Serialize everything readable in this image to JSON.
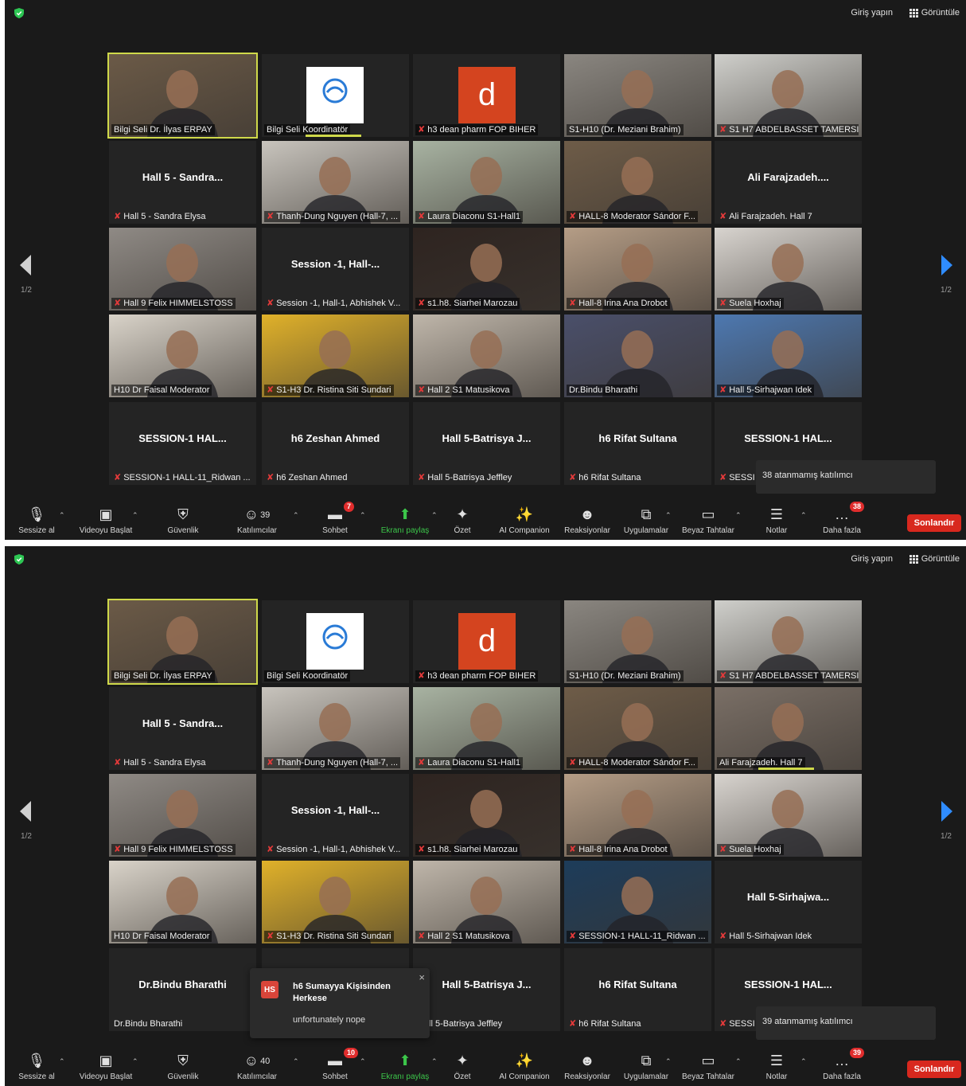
{
  "screens": [
    {
      "topbar": {
        "login": "Giriş yapın",
        "view": "Görüntüle"
      },
      "page_indicator": "1/2",
      "tiles": [
        {
          "name": "Bilgi Seli Dr. İlyas ERPAY",
          "muted": false,
          "kind": "video",
          "active": true,
          "bg": "#6b5a47"
        },
        {
          "name": "Bilgi Seli  Koordinatör",
          "muted": false,
          "kind": "logo",
          "speaking": true
        },
        {
          "name": "h3 dean pharm FOP BIHER",
          "muted": true,
          "kind": "letter",
          "letter": "d"
        },
        {
          "name": "S1-H10 (Dr. Meziani Brahim)",
          "muted": false,
          "kind": "video",
          "bg": "#8a8680"
        },
        {
          "name": "S1 H7 ABDELBASSET TAMERSIT",
          "muted": true,
          "kind": "video",
          "bg": "#cfcfcb"
        },
        {
          "name": "Hall 5 - Sandra Elysa",
          "muted": true,
          "kind": "text",
          "center": "Hall 5 - Sandra..."
        },
        {
          "name": "Thanh-Dung Nguyen (Hall-7, ...",
          "muted": true,
          "kind": "video",
          "bg": "#c8c4bd"
        },
        {
          "name": "Laura Diaconu S1-Hall1",
          "muted": true,
          "kind": "video",
          "bg": "#a8b3a2"
        },
        {
          "name": "HALL-8 Moderator Sándor F...",
          "muted": true,
          "kind": "video",
          "bg": "#6e5c48"
        },
        {
          "name": "Ali Farajzadeh. Hall 7",
          "muted": true,
          "kind": "text",
          "center": "Ali Farajzadeh...."
        },
        {
          "name": "Hall 9 Felix HIMMELSTOSS",
          "muted": true,
          "kind": "video",
          "bg": "#8f8a85"
        },
        {
          "name": "Session -1, Hall-1, Abhishek V...",
          "muted": true,
          "kind": "text",
          "center": "Session -1, Hall-..."
        },
        {
          "name": "s1.h8. Siarhei Marozau",
          "muted": true,
          "kind": "video",
          "bg": "#2e2420"
        },
        {
          "name": "Hall-8 Irina Ana Drobot",
          "muted": true,
          "kind": "video",
          "bg": "#b59d86"
        },
        {
          "name": "Suela Hoxhaj",
          "muted": true,
          "kind": "video",
          "bg": "#d8d4cf"
        },
        {
          "name": "H10 Dr Faisal Moderator",
          "muted": false,
          "kind": "video",
          "bg": "#d9d3c9"
        },
        {
          "name": "S1-H3 Dr. Ristina Siti Sundari",
          "muted": true,
          "kind": "video",
          "bg": "#e0b12a"
        },
        {
          "name": "Hall 2 S1 Matusikova",
          "muted": true,
          "kind": "video",
          "bg": "#bfb6aa"
        },
        {
          "name": "Dr.Bindu Bharathi",
          "muted": false,
          "kind": "video",
          "bg": "#4a4f6a"
        },
        {
          "name": "Hall 5-Sirhajwan Idek",
          "muted": true,
          "kind": "video",
          "bg": "#4d78b0"
        },
        {
          "name": "SESSION-1 HALL-11_Ridwan ...",
          "muted": true,
          "kind": "text",
          "center": "SESSION-1  HAL..."
        },
        {
          "name": "h6 Zeshan Ahmed",
          "muted": true,
          "kind": "text",
          "center": "h6 Zeshan Ahmed"
        },
        {
          "name": "Hall 5-Batrisya Jeffley",
          "muted": true,
          "kind": "text",
          "center": "Hall 5-Batrisya J..."
        },
        {
          "name": "h6 Rifat Sultana",
          "muted": true,
          "kind": "text",
          "center": "h6 Rifat Sultana"
        },
        {
          "name": "SESSI",
          "muted": true,
          "kind": "text",
          "center": "SESSION-1  HAL..."
        }
      ],
      "toast": "38 atanmamış katılımcı",
      "toolbar": {
        "mute": "Sessize al",
        "video": "Videoyu Başlat",
        "security": "Güvenlik",
        "participants": "Katılımcılar",
        "participants_count": "39",
        "chat": "Sohbet",
        "chat_badge": "7",
        "share": "Ekranı paylaş",
        "summary": "Özet",
        "ai": "AI Companion",
        "reactions": "Reaksiyonlar",
        "apps": "Uygulamalar",
        "whiteboard": "Beyaz Tahtalar",
        "notes": "Notlar",
        "more": "Daha fazla",
        "more_badge": "38",
        "end": "Sonlandır"
      }
    },
    {
      "topbar": {
        "login": "Giriş yapın",
        "view": "Görüntüle"
      },
      "page_indicator": "1/2",
      "tiles": [
        {
          "name": "Bilgi Seli Dr. İlyas ERPAY",
          "muted": false,
          "kind": "video",
          "active": true,
          "bg": "#6b5a47"
        },
        {
          "name": "Bilgi Seli  Koordinatör",
          "muted": false,
          "kind": "logo"
        },
        {
          "name": "h3 dean pharm FOP BIHER",
          "muted": true,
          "kind": "letter",
          "letter": "d"
        },
        {
          "name": "S1-H10 (Dr. Meziani Brahim)",
          "muted": false,
          "kind": "video",
          "bg": "#8a8680"
        },
        {
          "name": "S1 H7 ABDELBASSET TAMERSIT",
          "muted": true,
          "kind": "video",
          "bg": "#cfcfcb"
        },
        {
          "name": "Hall 5 - Sandra Elysa",
          "muted": true,
          "kind": "text",
          "center": "Hall 5 - Sandra..."
        },
        {
          "name": "Thanh-Dung Nguyen (Hall-7, ...",
          "muted": true,
          "kind": "video",
          "bg": "#c8c4bd"
        },
        {
          "name": "Laura Diaconu S1-Hall1",
          "muted": true,
          "kind": "video",
          "bg": "#a8b3a2"
        },
        {
          "name": "HALL-8 Moderator Sándor F...",
          "muted": true,
          "kind": "video",
          "bg": "#6e5c48"
        },
        {
          "name": "Ali Farajzadeh. Hall 7",
          "muted": false,
          "kind": "video",
          "bg": "#7a6f66",
          "speaking": true
        },
        {
          "name": "Hall 9 Felix HIMMELSTOSS",
          "muted": true,
          "kind": "video",
          "bg": "#8f8a85"
        },
        {
          "name": "Session -1, Hall-1, Abhishek V...",
          "muted": true,
          "kind": "text",
          "center": "Session -1, Hall-..."
        },
        {
          "name": "s1.h8. Siarhei Marozau",
          "muted": true,
          "kind": "video",
          "bg": "#2e2420"
        },
        {
          "name": "Hall-8 Irina Ana Drobot",
          "muted": true,
          "kind": "video",
          "bg": "#b59d86"
        },
        {
          "name": "Suela Hoxhaj",
          "muted": true,
          "kind": "video",
          "bg": "#d8d4cf"
        },
        {
          "name": "H10 Dr Faisal Moderator",
          "muted": false,
          "kind": "video",
          "bg": "#d9d3c9"
        },
        {
          "name": "S1-H3 Dr. Ristina Siti Sundari",
          "muted": true,
          "kind": "video",
          "bg": "#e0b12a"
        },
        {
          "name": "Hall 2 S1 Matusikova",
          "muted": true,
          "kind": "video",
          "bg": "#bfb6aa"
        },
        {
          "name": "SESSION-1 HALL-11_Ridwan ...",
          "muted": true,
          "kind": "video",
          "bg": "#1d3c5a"
        },
        {
          "name": "Hall 5-Sirhajwan Idek",
          "muted": true,
          "kind": "text",
          "center": "Hall 5-Sirhajwa..."
        },
        {
          "name": "Dr.Bindu Bharathi",
          "muted": false,
          "kind": "text",
          "center": "Dr.Bindu Bharathi"
        },
        {
          "name": "",
          "muted": false,
          "kind": "text",
          "center": ""
        },
        {
          "name": "Hall 5-Batrisya Jeffley",
          "muted": false,
          "kind": "text",
          "center": "Hall 5-Batrisya J..."
        },
        {
          "name": "h6 Rifat Sultana",
          "muted": true,
          "kind": "text",
          "center": "h6 Rifat Sultana"
        },
        {
          "name": "SESSI",
          "muted": true,
          "kind": "text",
          "center": "SESSION-1  HAL..."
        }
      ],
      "toast": "39 atanmamış katılımcı",
      "chat_notification": {
        "initials": "HS",
        "title": "h6 Sumayya Kişisinden Herkese",
        "body": "unfortunately nope",
        "close": "×"
      },
      "toolbar": {
        "mute": "Sessize al",
        "video": "Videoyu Başlat",
        "security": "Güvenlik",
        "participants": "Katılımcılar",
        "participants_count": "40",
        "chat": "Sohbet",
        "chat_badge": "10",
        "share": "Ekranı paylaş",
        "summary": "Özet",
        "ai": "AI Companion",
        "reactions": "Reaksiyonlar",
        "apps": "Uygulamalar",
        "whiteboard": "Beyaz Tahtalar",
        "notes": "Notlar",
        "more": "Daha fazla",
        "more_badge": "39",
        "end": "Sonlandır"
      }
    }
  ],
  "colors": {
    "accent_green": "#3cc64a",
    "end_red": "#d8281e",
    "active_border": "#cfd94a",
    "badge_red": "#e02d2d",
    "nav_blue": "#2f8cff"
  }
}
